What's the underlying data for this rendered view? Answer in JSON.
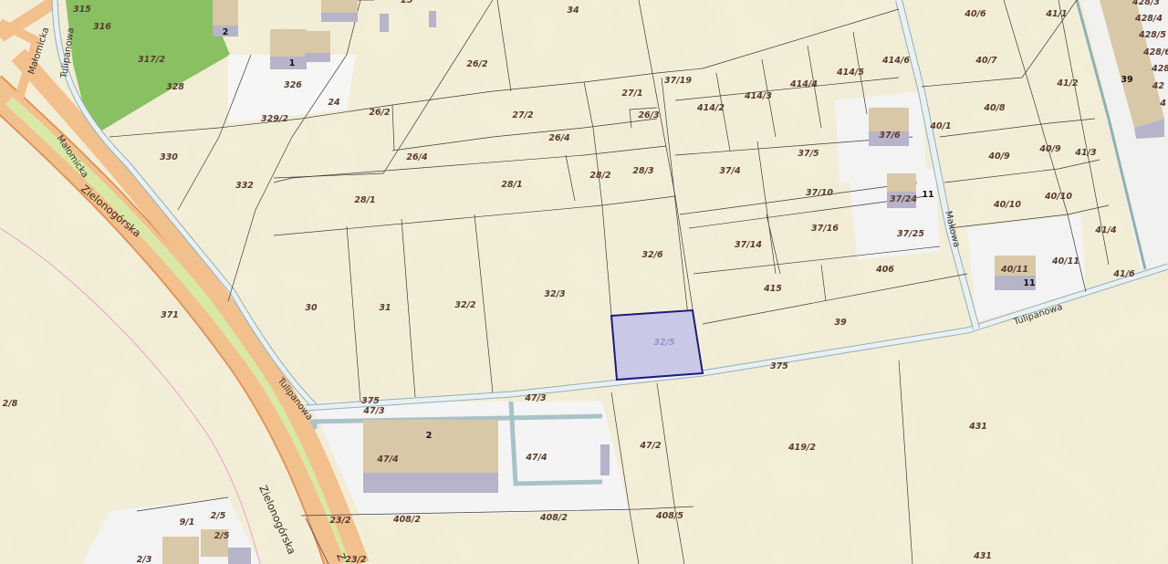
{
  "map": {
    "highlighted_parcel": "32/5",
    "highlight_color": "#c9c8e6",
    "highlight_border": "#1f1a7a",
    "colors": {
      "background": "#f4efd9",
      "road_main": "#f2c08d",
      "road_edge": "#e0955a",
      "green_strip": "#d9e8a6",
      "forest": "#7dbb55",
      "paved_area": "#f3f3f3",
      "building_roof": "#d9c8a8",
      "building_wall": "#b7b3c8",
      "minor_road": "#e8eef0"
    }
  },
  "streets": {
    "zielonogorska_1": "Zielonogórska",
    "zielonogorska_2": "Zielonogórska",
    "zielonogorska_3": "Z",
    "tulipanowa_left": "Tulipanowa",
    "tulipanowa_right": "Tulipanowa",
    "tulipanowa_top": "Tulipanowa",
    "makowa": "Makowa",
    "malomicka_1": "Małomicka",
    "malomicka_2": "Małomicka"
  },
  "parcels": {
    "p315": "315",
    "p316": "316",
    "p317_2": "317/2",
    "p328": "328",
    "p326": "326",
    "p329_2": "329/2",
    "p24": "24",
    "p330": "330",
    "p332": "332",
    "p34": "34",
    "p26_2": "26/2",
    "p26_2b": "26/2",
    "p27_1": "27/1",
    "p27_2": "27/2",
    "p26_3": "26/3",
    "p26_4": "26/4",
    "p26_4b": "26/4",
    "p28_2": "28/2",
    "p28_3": "28/3",
    "p28_1": "28/1",
    "p28_1b": "28/1",
    "p37_19": "37/19",
    "p414_2": "414/2",
    "p414_3": "414/3",
    "p414_4": "414/4",
    "p414_5": "414/5",
    "p414_6": "414/6",
    "p37_6": "37/6",
    "p37_4": "37/4",
    "p37_5": "37/5",
    "p37_10": "37/10",
    "p37_24": "37/24",
    "p37_14": "37/14",
    "p37_16": "37/16",
    "p37_25": "37/25",
    "p406": "406",
    "p415": "415",
    "p39": "39",
    "p32_6": "32/6",
    "p32_3": "32/3",
    "p32_2": "32/2",
    "p31": "31",
    "p30": "30",
    "p32_5": "32/5",
    "p375a": "375",
    "p375b": "375",
    "p40_6": "40/6",
    "p41_1": "41/1",
    "p40_7": "40/7",
    "p41_2": "41/2",
    "p40_8": "40/8",
    "p40_1": "40/1",
    "p40_9": "40/9",
    "p40_9b": "40/9",
    "p41_3": "41/3",
    "p40_10": "40/10",
    "p40_10b": "40/10",
    "p41_4": "41/4",
    "p40_11": "40/11",
    "p40_11b": "40/11",
    "p41_6": "41/6",
    "p428_3": "428/3",
    "p428_4": "428/4",
    "p428_5": "428/5",
    "p428_6": "428/6",
    "p428_x": "428",
    "p42": "42",
    "p4": "4",
    "p371": "371",
    "p2_8": "2/8",
    "p47_3a": "47/3",
    "p47_3b": "47/3",
    "p47_4a": "47/4",
    "p47_4b": "47/4",
    "p47_2": "47/2",
    "p419_2": "419/2",
    "p431a": "431",
    "p431b": "431",
    "p408_2a": "408/2",
    "p408_2b": "408/2",
    "p408_5": "408/5",
    "p23_2a": "23/2",
    "p23_2b": "23/2",
    "p9_1": "9/1",
    "p2_5a": "2/5",
    "p2_5b": "2/5",
    "p2_3": "2/3",
    "p25": "25"
  },
  "house_numbers": {
    "h2_top": "2",
    "h1": "1",
    "h11_a": "11",
    "h11_b": "11",
    "h39": "39",
    "h2_mid": "2"
  }
}
